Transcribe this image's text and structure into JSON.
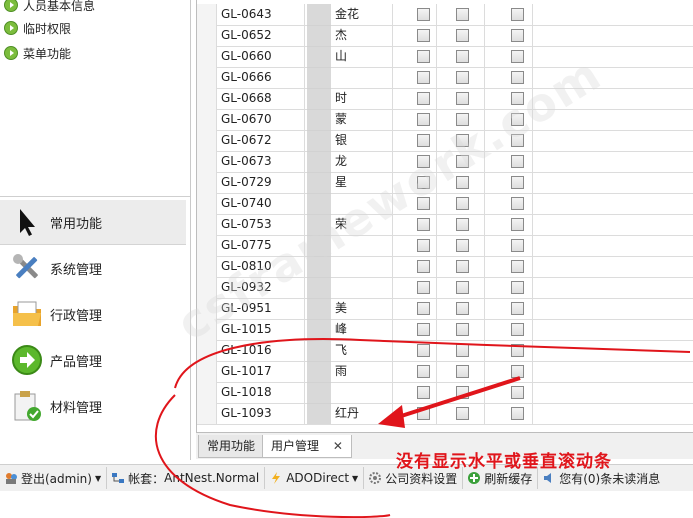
{
  "tree": {
    "items": [
      {
        "label": "人员基本信息"
      },
      {
        "label": "临时权限"
      },
      {
        "label": "菜单功能"
      }
    ]
  },
  "nav": {
    "items": [
      {
        "label": "常用功能",
        "icon": "cursor-arrow-icon",
        "active": true
      },
      {
        "label": "系统管理",
        "icon": "tools-icon"
      },
      {
        "label": "行政管理",
        "icon": "folder-icon"
      },
      {
        "label": "产品管理",
        "icon": "green-arrow-icon"
      },
      {
        "label": "材料管理",
        "icon": "clipboard-check-icon"
      }
    ]
  },
  "grid": {
    "rows": [
      {
        "code": "GL-0643",
        "name": "金花"
      },
      {
        "code": "GL-0652",
        "name": "杰"
      },
      {
        "code": "GL-0660",
        "name": "山"
      },
      {
        "code": "GL-0666",
        "name": ""
      },
      {
        "code": "GL-0668",
        "name": "时"
      },
      {
        "code": "GL-0670",
        "name": "蒙"
      },
      {
        "code": "GL-0672",
        "name": "银"
      },
      {
        "code": "GL-0673",
        "name": "龙"
      },
      {
        "code": "GL-0729",
        "name": "星"
      },
      {
        "code": "GL-0740",
        "name": ""
      },
      {
        "code": "GL-0753",
        "name": "荣"
      },
      {
        "code": "GL-0775",
        "name": ""
      },
      {
        "code": "GL-0810",
        "name": ""
      },
      {
        "code": "GL-0932",
        "name": ""
      },
      {
        "code": "GL-0951",
        "name": "美"
      },
      {
        "code": "GL-1015",
        "name": "峰"
      },
      {
        "code": "GL-1016",
        "name": "飞"
      },
      {
        "code": "GL-1017",
        "name": "雨"
      },
      {
        "code": "GL-1018",
        "name": ""
      },
      {
        "code": "GL-1093",
        "name": "红丹"
      }
    ]
  },
  "tabs": [
    {
      "label": "常用功能",
      "selected": false
    },
    {
      "label": "用户管理",
      "selected": true,
      "close": "✕"
    }
  ],
  "status": {
    "login": "登出(admin)",
    "account_prefix": "帐套：",
    "account": "AntNest.Normal",
    "db": "ADODirect",
    "company": "公司资料设置",
    "refresh": "刷新缓存",
    "messages": "您有(0)条未读消息"
  },
  "annotation": {
    "text": "没有显示水平或垂直滚动条",
    "color": "#e0151b"
  },
  "watermark": "csframework.com"
}
